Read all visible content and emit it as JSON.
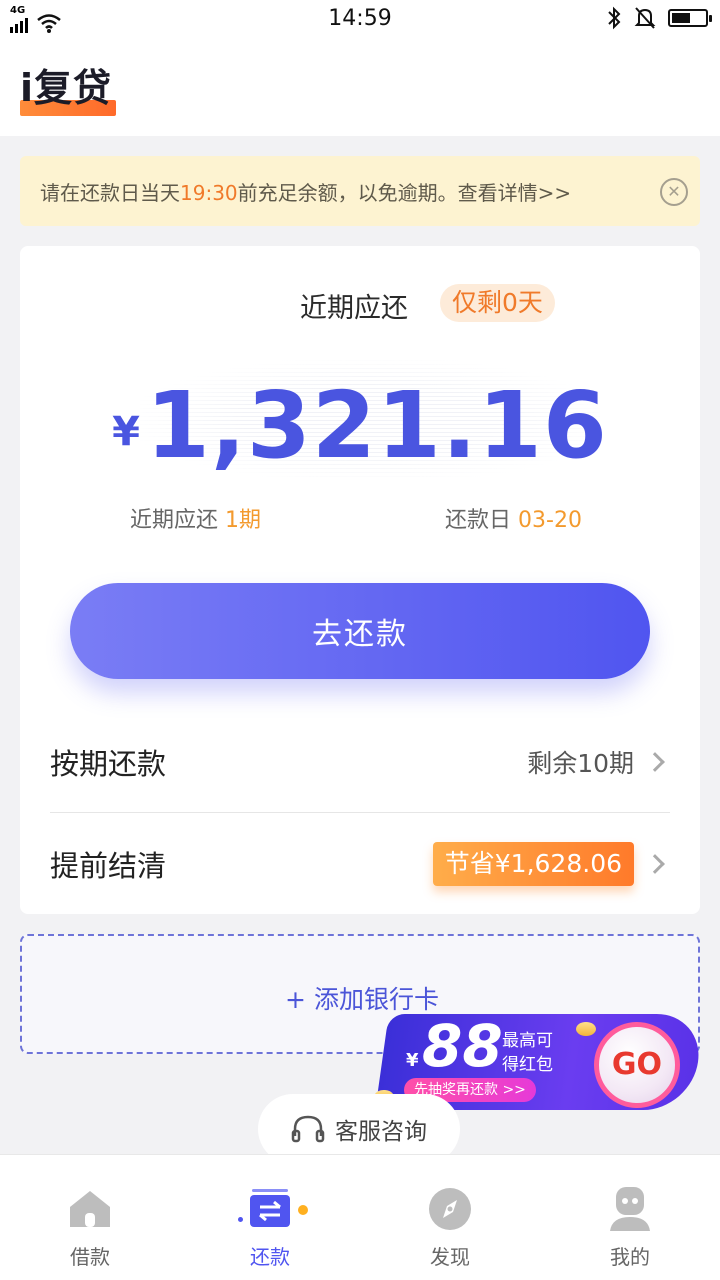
{
  "status_bar": {
    "network": "4G",
    "time": "14:59",
    "battery_level": 0.55
  },
  "header": {
    "logo_text": "i复贷"
  },
  "notice": {
    "text_before": "请在还款日当天",
    "text_highlight": "19:30",
    "text_after": "前充足余额，以免逾期。查看详情>>",
    "close_icon": "close-icon"
  },
  "repayment": {
    "title": "近期应还",
    "days_left": "仅剩0天",
    "currency": "¥",
    "amount": "1,321.16",
    "periods_label": "近期应还",
    "periods_value": "1期",
    "due_label": "还款日",
    "due_value": "03-20",
    "pay_button": "去还款"
  },
  "options": {
    "installment_label": "按期还款",
    "installment_value": "剩余10期",
    "early_label": "提前结清",
    "early_value": "节省¥1,628.06"
  },
  "add_card": {
    "label": "+ 添加银行卡"
  },
  "promo": {
    "currency": "¥",
    "amount": "88",
    "line1": "最高可",
    "line2": "得红包",
    "pill": "先抽奖再还款 >>",
    "go": "GO"
  },
  "service": {
    "label": "客服咨询"
  },
  "bottom_nav": {
    "items": [
      {
        "label": "借款",
        "icon": "home-icon"
      },
      {
        "label": "还款",
        "icon": "repay-icon"
      },
      {
        "label": "发现",
        "icon": "compass-icon"
      },
      {
        "label": "我的",
        "icon": "profile-icon"
      }
    ],
    "active": "还款"
  },
  "colors": {
    "accent": "#5055f0",
    "orange": "#f07a2a",
    "notice_bg": "#fdf3d1"
  }
}
